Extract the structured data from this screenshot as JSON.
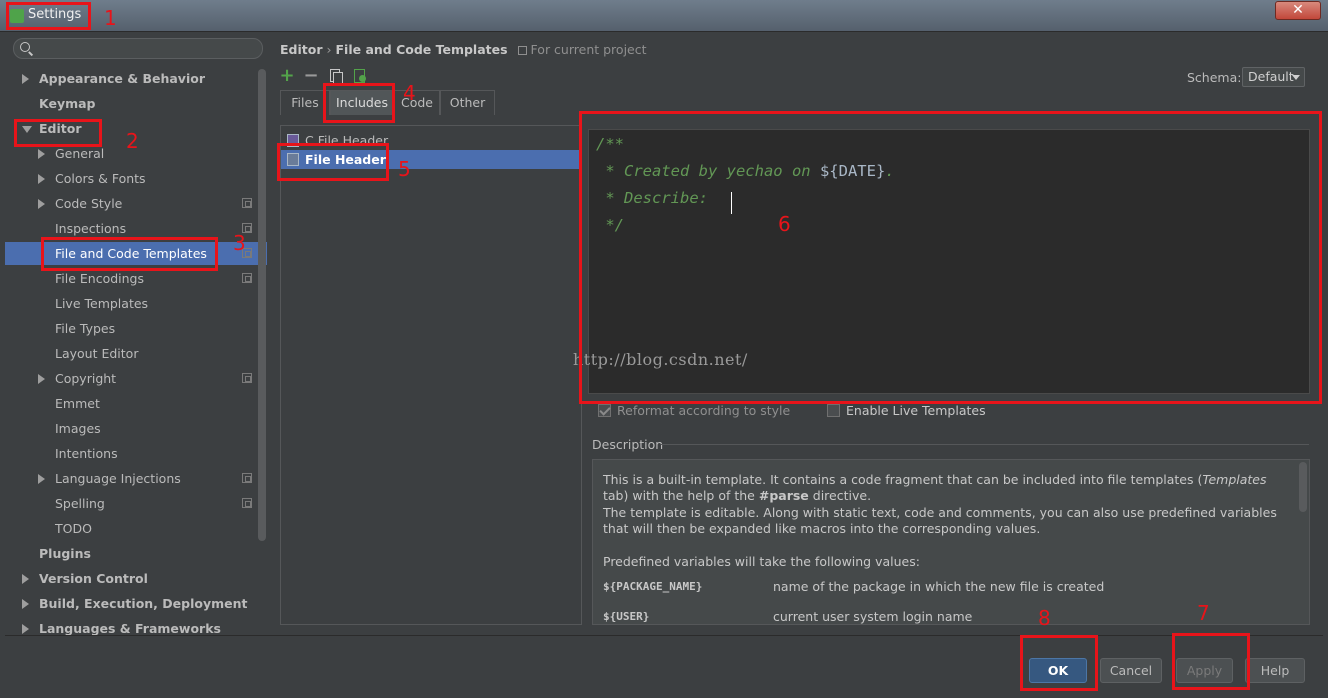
{
  "window": {
    "title": "Settings",
    "close_glyph": "✕"
  },
  "search": {
    "placeholder": ""
  },
  "sidebar": {
    "items": [
      {
        "label": "Appearance & Behavior",
        "level": 0,
        "arrow": "right",
        "proj": false
      },
      {
        "label": "Keymap",
        "level": 0,
        "arrow": "none",
        "proj": false
      },
      {
        "label": "Editor",
        "level": 0,
        "arrow": "down",
        "proj": false
      },
      {
        "label": "General",
        "level": 1,
        "arrow": "right",
        "proj": false
      },
      {
        "label": "Colors & Fonts",
        "level": 1,
        "arrow": "right",
        "proj": false
      },
      {
        "label": "Code Style",
        "level": 1,
        "arrow": "right",
        "proj": true
      },
      {
        "label": "Inspections",
        "level": 1,
        "arrow": "none",
        "proj": true
      },
      {
        "label": "File and Code Templates",
        "level": 1,
        "arrow": "none",
        "proj": true,
        "selected": true
      },
      {
        "label": "File Encodings",
        "level": 1,
        "arrow": "none",
        "proj": true
      },
      {
        "label": "Live Templates",
        "level": 1,
        "arrow": "none",
        "proj": false
      },
      {
        "label": "File Types",
        "level": 1,
        "arrow": "none",
        "proj": false
      },
      {
        "label": "Layout Editor",
        "level": 1,
        "arrow": "none",
        "proj": false
      },
      {
        "label": "Copyright",
        "level": 1,
        "arrow": "right",
        "proj": true
      },
      {
        "label": "Emmet",
        "level": 1,
        "arrow": "none",
        "proj": false
      },
      {
        "label": "Images",
        "level": 1,
        "arrow": "none",
        "proj": false
      },
      {
        "label": "Intentions",
        "level": 1,
        "arrow": "none",
        "proj": false
      },
      {
        "label": "Language Injections",
        "level": 1,
        "arrow": "right",
        "proj": true
      },
      {
        "label": "Spelling",
        "level": 1,
        "arrow": "none",
        "proj": true
      },
      {
        "label": "TODO",
        "level": 1,
        "arrow": "none",
        "proj": false
      },
      {
        "label": "Plugins",
        "level": 0,
        "arrow": "none",
        "proj": false
      },
      {
        "label": "Version Control",
        "level": 0,
        "arrow": "right",
        "proj": false
      },
      {
        "label": "Build, Execution, Deployment",
        "level": 0,
        "arrow": "right",
        "proj": false
      },
      {
        "label": "Languages & Frameworks",
        "level": 0,
        "arrow": "right",
        "proj": false
      }
    ]
  },
  "breadcrumb": {
    "parent": "Editor",
    "separator": "›",
    "current": "File and Code Templates",
    "note": "For current project"
  },
  "toolbar": {
    "add": "+",
    "remove": "−"
  },
  "schema": {
    "label": "Schema:",
    "value": "Default"
  },
  "tabs": [
    {
      "label": "Files",
      "active": false
    },
    {
      "label": "Includes",
      "active": true
    },
    {
      "label": "Code",
      "active": false
    },
    {
      "label": "Other",
      "active": false
    }
  ],
  "templates": [
    {
      "label": "C File Header",
      "selected": false,
      "icon": "c-file-icon"
    },
    {
      "label": "File Header",
      "selected": true,
      "icon": "file-icon"
    }
  ],
  "editor": {
    "line1": "/**",
    "line2_pre": " * Created by yechao on ",
    "line2_var": "${DATE}",
    "line2_post": ".",
    "line3": " * Describe:",
    "line4": " */",
    "watermark": "http://blog.csdn.net/"
  },
  "options": {
    "reformat": {
      "label": "Reformat according to style",
      "checked": true
    },
    "live_templates": {
      "label": "Enable Live Templates",
      "checked": false
    }
  },
  "description": {
    "label": "Description",
    "p1_a": "This is a built-in template. It contains a code fragment that can be included into file templates (",
    "p1_em": "Templates",
    "p1_b": "tab) with the help of the ",
    "p1_strong": "#parse",
    "p1_c": " directive.",
    "p2": "The template is editable. Along with static text, code and comments, you can also use predefined variables that will then be expanded like macros into the corresponding values.",
    "p3": "Predefined variables will take the following values:",
    "vars": [
      {
        "name": "${PACKAGE_NAME}",
        "desc": "name of the package in which the new file is created"
      },
      {
        "name": "${USER}",
        "desc": "current user system login name"
      }
    ]
  },
  "buttons": {
    "ok": "OK",
    "cancel": "Cancel",
    "apply": "Apply",
    "help": "Help"
  },
  "annotations": [
    "1",
    "2",
    "3",
    "4",
    "5",
    "6",
    "7",
    "8"
  ],
  "colors": {
    "accent_selection": "#4b6eaf",
    "annotation": "#e8141a",
    "comment": "#629755"
  }
}
